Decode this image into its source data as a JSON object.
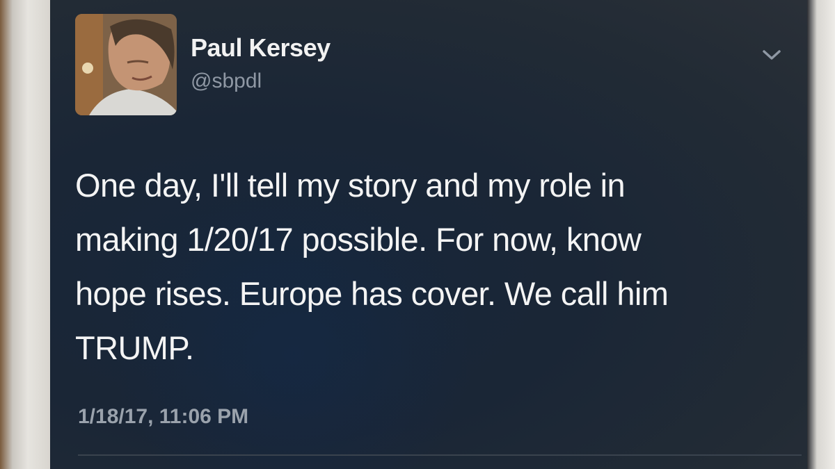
{
  "tweet": {
    "author": {
      "display_name": "Paul Kersey",
      "handle": "@sbpdl",
      "avatar_icon": "profile-photo"
    },
    "text_lines": [
      "One day, I'll tell my story and my role in",
      "making 1/20/17 possible. For now, know",
      "hope rises. Europe has cover. We call him",
      "TRUMP."
    ],
    "timestamp": "1/18/17, 11:06 PM",
    "menu_icon": "chevron-down-icon"
  },
  "colors": {
    "background": "#1a2636",
    "text_primary": "#f4f4f4",
    "text_secondary": "#8f98a4"
  }
}
